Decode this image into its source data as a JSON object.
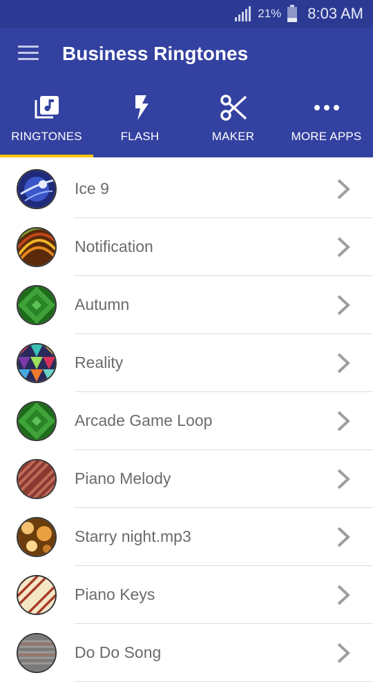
{
  "status_bar": {
    "battery_percent": "21%",
    "time": "8:03 AM",
    "signal_icon": "signal-bars-icon",
    "battery_icon": "battery-icon"
  },
  "app_bar": {
    "title": "Business Ringtones",
    "menu_icon": "hamburger-menu-icon"
  },
  "tabs": [
    {
      "label": "RINGTONES",
      "icon": "music-library-icon",
      "selected": true
    },
    {
      "label": "FLASH",
      "icon": "flash-icon",
      "selected": false
    },
    {
      "label": "MAKER",
      "icon": "scissors-icon",
      "selected": false
    },
    {
      "label": "MORE APPS",
      "icon": "more-dots-icon",
      "selected": false
    }
  ],
  "ringtones": [
    {
      "name": "Ice 9",
      "thumb": "ice"
    },
    {
      "name": "Notification",
      "thumb": "swirl"
    },
    {
      "name": "Autumn",
      "thumb": "green"
    },
    {
      "name": "Reality",
      "thumb": "triangles"
    },
    {
      "name": "Arcade Game Loop",
      "thumb": "green"
    },
    {
      "name": "Piano Melody",
      "thumb": "stripes-red"
    },
    {
      "name": "Starry night.mp3",
      "thumb": "bokeh"
    },
    {
      "name": "Piano Keys",
      "thumb": "stripes-cream"
    },
    {
      "name": "Do Do Song",
      "thumb": "gray"
    }
  ],
  "colors": {
    "status_bar": "#2c3a94",
    "app_bar": "#3341a0",
    "tab_indicator": "#f7c400",
    "row_text": "#6b6b6b",
    "chevron": "#9e9e9e"
  }
}
